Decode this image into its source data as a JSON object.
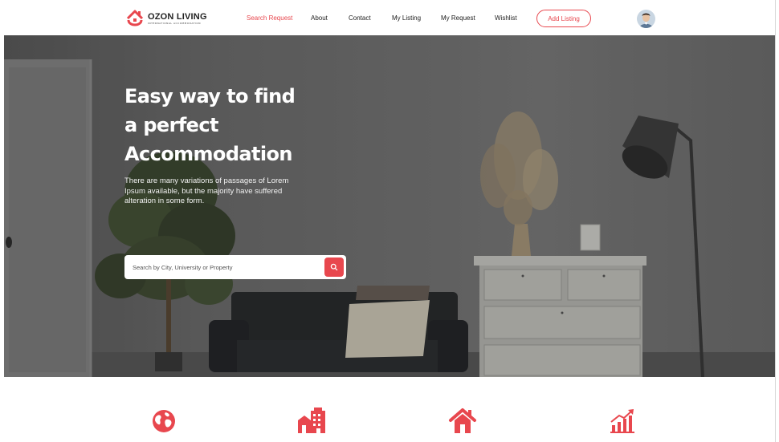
{
  "brand": {
    "name": "OZON LIVING",
    "tagline": "INTERNATIONAL ACCOMMODATION",
    "accent_color": "#e8474e"
  },
  "nav": {
    "items": [
      {
        "label": "Search Request",
        "active": true
      },
      {
        "label": "About",
        "active": false
      },
      {
        "label": "Contact",
        "active": false
      },
      {
        "label": "My Listing",
        "active": false
      },
      {
        "label": "My Request",
        "active": false
      },
      {
        "label": "Wishlist",
        "active": false
      }
    ],
    "add_listing_label": "Add Listing",
    "avatar_icon": "user-avatar"
  },
  "hero": {
    "title_lines": [
      "Easy way to find",
      "a perfect",
      "Accommodation"
    ],
    "description": "There are many variations of passages of Lorem Ipsum available, but the majority have suffered alteration in some form.",
    "search": {
      "placeholder": "Search by City, University or Property",
      "value": "",
      "button_icon": "search-icon"
    }
  },
  "features": {
    "icons": [
      "globe-icon",
      "buildings-icon",
      "home-icon",
      "growth-chart-icon"
    ]
  }
}
